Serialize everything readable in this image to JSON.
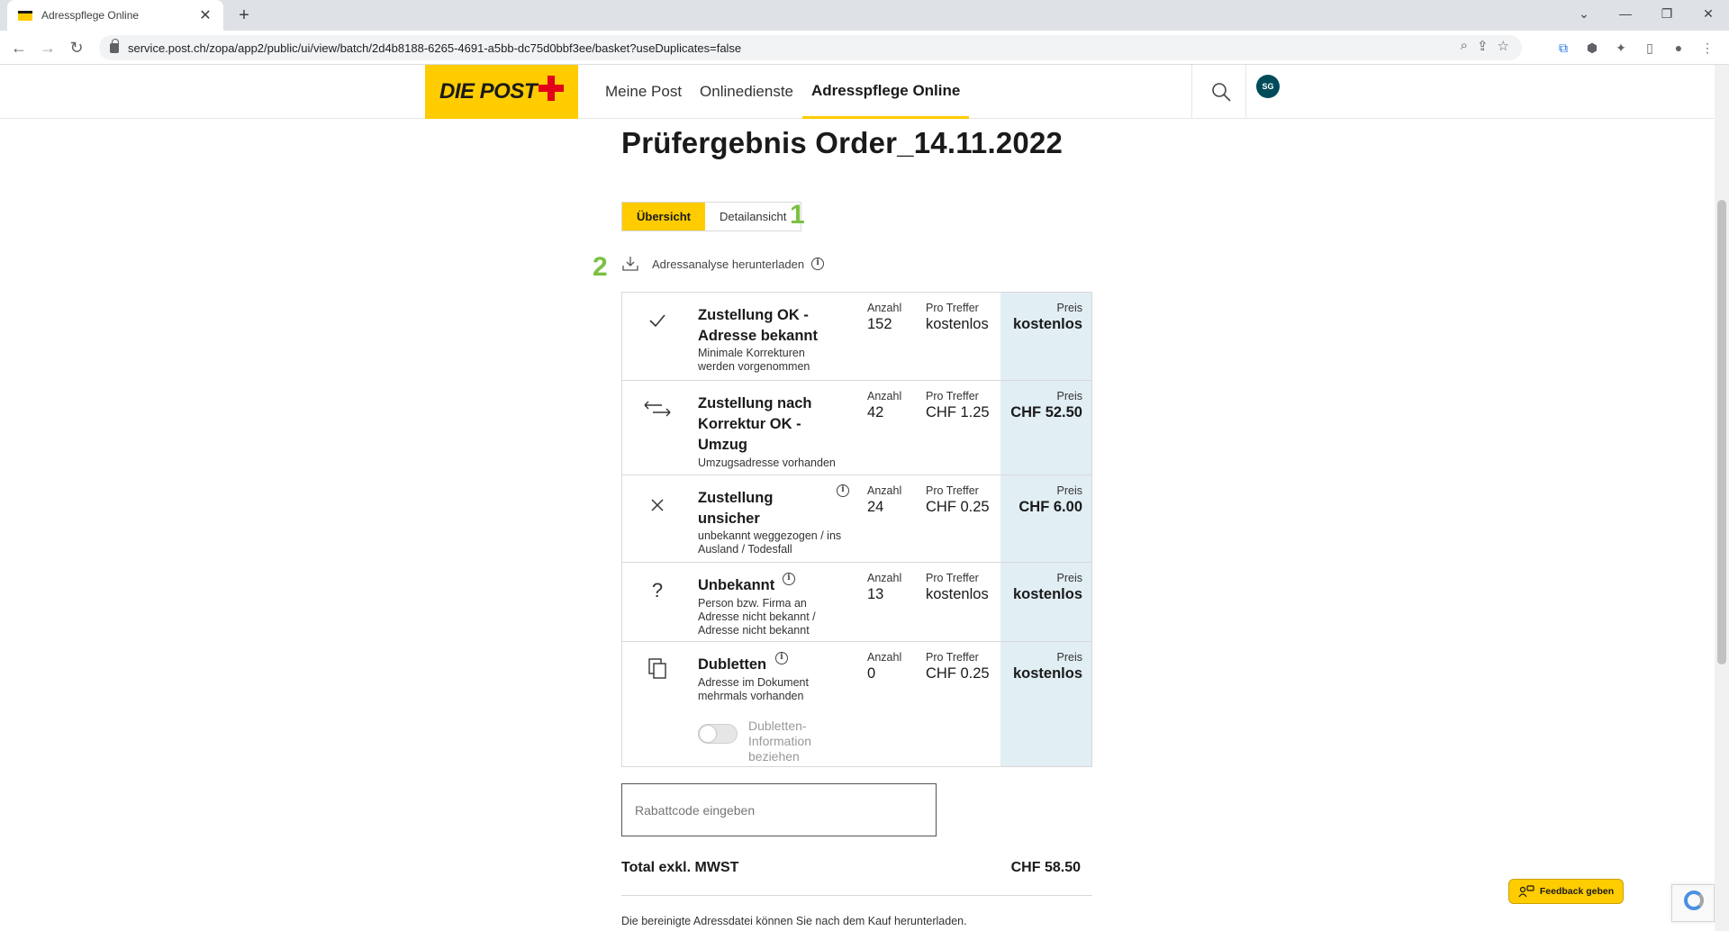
{
  "browser": {
    "tab_title": "Adresspflege Online",
    "url": "service.post.ch/zopa/app2/public/ui/view/batch/2d4b8188-6265-4691-a5bb-dc75d0bbf3ee/basket?useDuplicates=false"
  },
  "header": {
    "logo_text": "DIE POST",
    "nav": [
      "Meine Post",
      "Onlinedienste",
      "Adresspflege Online"
    ],
    "active_nav": "Adresspflege Online",
    "avatar_initials": "SG"
  },
  "page": {
    "title": "Prüfergebnis Order_14.11.2022",
    "tabs": {
      "overview": "Übersicht",
      "detail": "Detailansicht"
    },
    "markers": {
      "one": "1",
      "two": "2"
    },
    "download_label": "Adressanalyse herunterladen",
    "info_glyph": "i"
  },
  "results": {
    "col_count_label": "Anzahl",
    "col_unit_label": "Pro Treffer",
    "col_price_label": "Preis",
    "rows": [
      {
        "icon": "check-icon",
        "title": "Zustellung OK - Adresse bekannt",
        "subtitle": "Minimale Korrekturen werden vorgenommen",
        "count": "152",
        "unit_price": "kostenlos",
        "price": "kostenlos"
      },
      {
        "icon": "arrows-exchange-icon",
        "title": "Zustellung nach Korrektur OK - Umzug",
        "subtitle": "Umzugsadresse vorhanden",
        "count": "42",
        "unit_price": "CHF 1.25",
        "price": "CHF 52.50"
      },
      {
        "icon": "cross-icon",
        "title": "Zustellung unsicher",
        "subtitle": "unbekannt weggezogen / ins Ausland / Todesfall",
        "count": "24",
        "unit_price": "CHF 0.25",
        "price": "CHF 6.00"
      },
      {
        "icon": "question-icon",
        "title": "Unbekannt",
        "subtitle": "Person bzw. Firma an Adresse nicht bekannt / Adresse nicht bekannt",
        "count": "13",
        "unit_price": "kostenlos",
        "price": "kostenlos"
      },
      {
        "icon": "duplicate-icon",
        "title": "Dubletten",
        "subtitle": "Adresse im Dokument mehrmals vorhanden",
        "count": "0",
        "unit_price": "CHF 0.25",
        "price": "kostenlos",
        "toggle_label": "Dubletten-Information beziehen",
        "toggle_on": false
      }
    ]
  },
  "discount": {
    "placeholder": "Rabattcode eingeben"
  },
  "total": {
    "label": "Total exkl. MWST",
    "value": "CHF 58.50"
  },
  "note": "Die bereinigte Adressdatei können Sie nach dem Kauf herunterladen.",
  "feedback_label": "Feedback geben",
  "colors": {
    "brand_yellow": "#ffcc00",
    "brand_red": "#e2001a",
    "price_bg": "#e1eef4",
    "marker_green": "#7ac143",
    "avatar_bg": "#004b5a"
  }
}
